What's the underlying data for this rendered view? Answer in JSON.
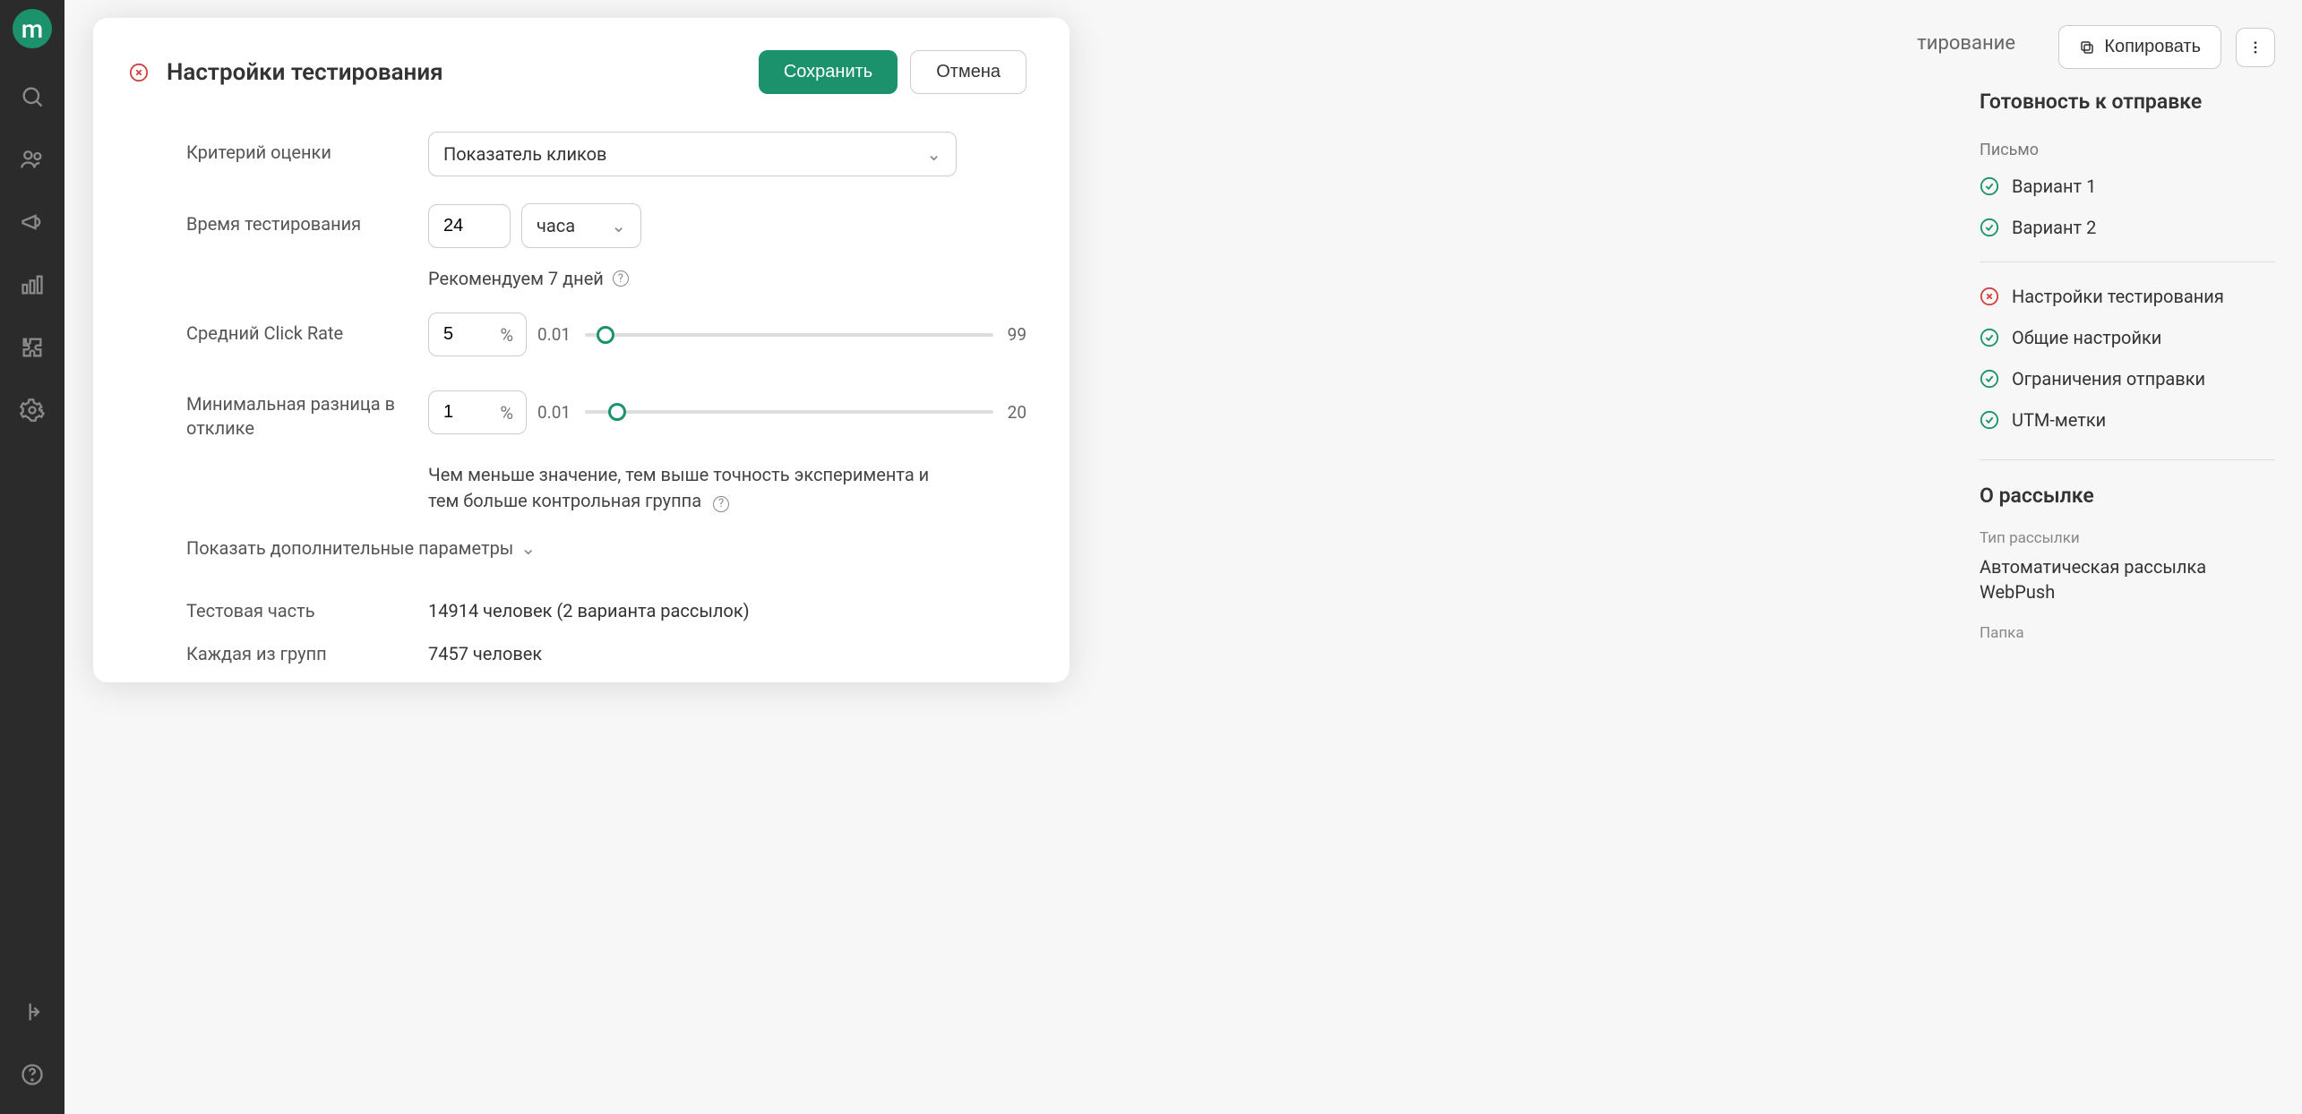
{
  "logo_letter": "m",
  "top_actions": {
    "partial_tab": "тирование",
    "copy_label": "Копировать"
  },
  "modal": {
    "title": "Настройки тестирования",
    "save_label": "Сохранить",
    "cancel_label": "Отмена",
    "criteria_label": "Критерий оценки",
    "criteria_value": "Показатель кликов",
    "duration_label": "Время тестирования",
    "duration_value": "24",
    "duration_unit": "часа",
    "recommend_text": "Рекомендуем 7 дней",
    "avg_cr_label": "Средний Click Rate",
    "avg_cr_value": "5",
    "avg_cr_unit": "%",
    "avg_cr_min": "0.01",
    "avg_cr_max": "99",
    "mindiff_label": "Минимальная разница в отклике",
    "mindiff_value": "1",
    "mindiff_unit": "%",
    "mindiff_min": "0.01",
    "mindiff_max": "20",
    "mindiff_hint": "Чем меньше значение, тем выше точность эксперимента и тем больше контрольная группа",
    "expand_label": "Показать дополнительные параметры",
    "test_part_label": "Тестовая часть",
    "test_part_value": "14914 человек (2 варианта рассылок)",
    "each_group_label": "Каждая из групп",
    "each_group_value": "7457 человек"
  },
  "readiness": {
    "title": "Готовность к отправке",
    "letter_label": "Письмо",
    "items": [
      {
        "label": "Вариант 1",
        "status": "ok"
      },
      {
        "label": "Вариант 2",
        "status": "ok"
      }
    ],
    "settings": [
      {
        "label": "Настройки тестирования",
        "status": "error"
      },
      {
        "label": "Общие настройки",
        "status": "ok"
      },
      {
        "label": "Ограничения отправки",
        "status": "ok"
      },
      {
        "label": "UTM-метки",
        "status": "ok"
      }
    ]
  },
  "about": {
    "title": "О рассылке",
    "type_label": "Тип рассылки",
    "type_value": "Автоматическая рассылка WebPush",
    "folder_label": "Папка"
  }
}
